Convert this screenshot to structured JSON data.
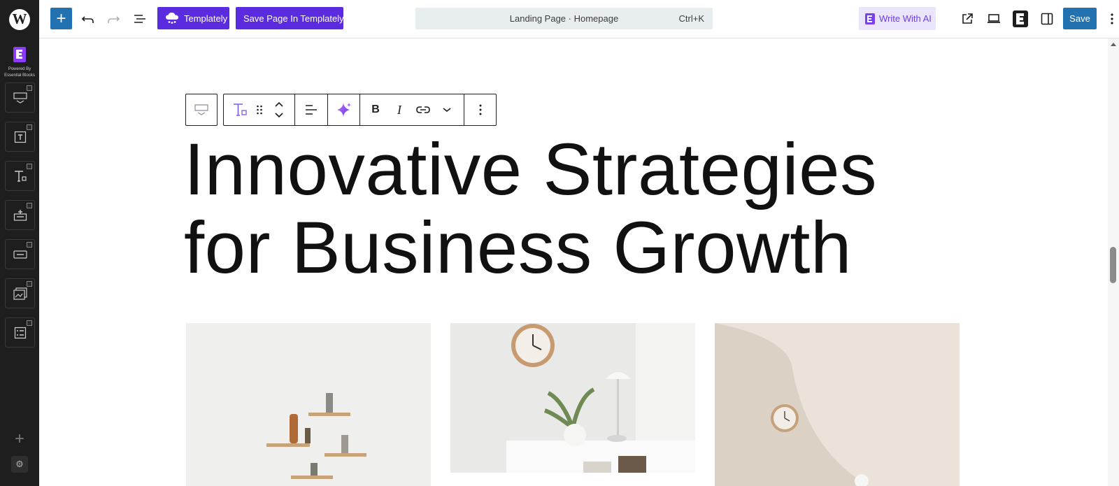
{
  "header": {
    "templately_label": "Templately",
    "save_in_templately_label": "Save Page In Templately",
    "document_title": "Landing Page · Homepage",
    "shortcut": "Ctrl+K",
    "write_ai_label": "Write With AI",
    "save_label": "Save"
  },
  "sidebar": {
    "brand_line1": "Powered By",
    "brand_line2": "Essential Blocks",
    "items": [
      {
        "icon": "advanced-heading-icon"
      },
      {
        "icon": "text-frame-icon"
      },
      {
        "icon": "typography-icon"
      },
      {
        "icon": "call-to-action-icon"
      },
      {
        "icon": "button-icon"
      },
      {
        "icon": "image-gallery-icon"
      },
      {
        "icon": "feature-list-icon"
      }
    ]
  },
  "block_toolbar": {
    "bold_label": "B",
    "italic_label": "I"
  },
  "content": {
    "headline_line1": "Innovative Strategies",
    "headline_line2": "for Business Growth"
  },
  "colors": {
    "wp_blue": "#2271b1",
    "templately_purple": "#5b2be0",
    "ai_purple": "#6a3ee6",
    "rail_dark": "#1e1e1e"
  }
}
